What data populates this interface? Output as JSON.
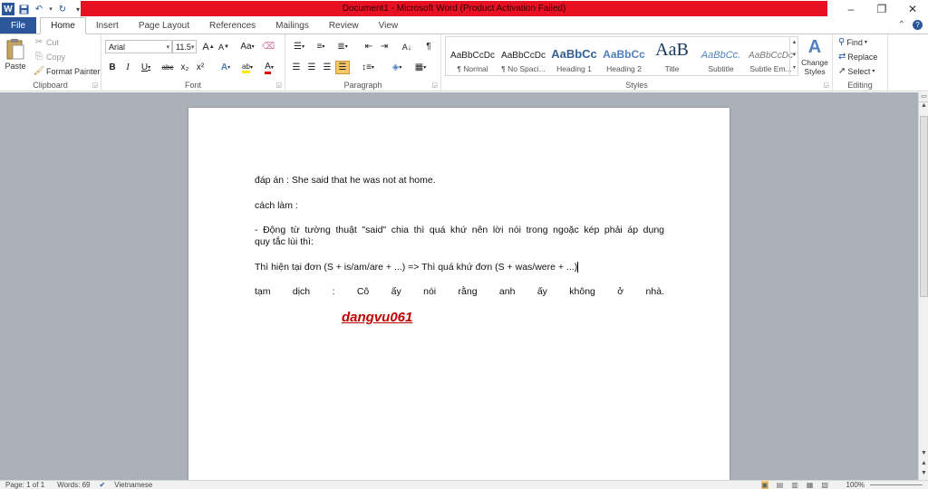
{
  "window": {
    "title": "Document1 - Microsoft Word (Product Activation Failed)",
    "minimize": "–",
    "restore": "❐",
    "close": "✕"
  },
  "tabs": [
    "File",
    "Home",
    "Insert",
    "Page Layout",
    "References",
    "Mailings",
    "Review",
    "View"
  ],
  "clipboard": {
    "paste": "Paste",
    "cut": "Cut",
    "copy": "Copy",
    "format_painter": "Format Painter",
    "label": "Clipboard"
  },
  "font": {
    "family": "Arial",
    "size": "11.5",
    "label": "Font",
    "bold": "B",
    "italic": "I",
    "underline": "U",
    "strike": "abc",
    "subscript": "x₂",
    "superscript": "x²",
    "grow": "A",
    "shrink": "A",
    "case": "Aa",
    "effects": "A",
    "highlight": "ab",
    "color": "A"
  },
  "paragraph": {
    "label": "Paragraph"
  },
  "styles": {
    "label": "Styles",
    "items": [
      {
        "preview": "AaBbCcDc",
        "name": "¶ Normal"
      },
      {
        "preview": "AaBbCcDc",
        "name": "¶ No Spaci..."
      },
      {
        "preview": "AaBbCc",
        "name": "Heading 1"
      },
      {
        "preview": "AaBbCc",
        "name": "Heading 2"
      },
      {
        "preview": "AaB",
        "name": "Title"
      },
      {
        "preview": "AaBbCc.",
        "name": "Subtitle"
      },
      {
        "preview": "AaBbCcDc",
        "name": "Subtle Em..."
      }
    ],
    "change_styles": "Change Styles"
  },
  "editing": {
    "find": "Find",
    "replace": "Replace",
    "select": "Select",
    "label": "Editing"
  },
  "document": {
    "line1": "đáp án : She said that he was not at home.",
    "line2": "cách làm :",
    "line3a": "- Động từ tường thuật \"said\" chia thì quá khứ nên lời nói trong ngoặc kép phải áp dụng",
    "line3b": "quy tắc lùi thì:",
    "line4": "Thì hiện tại đơn (S + is/am/are  + ...) => Thì quá khứ đơn (S + was/were  + ...)",
    "line5": "tạm dịch : Cô ấy nói rằng anh ấy không ở nhà.",
    "signature": "dangvu061"
  },
  "status": {
    "page": "Page: 1 of 1",
    "words": "Words: 69",
    "language": "Vietnamese",
    "zoom": "100%"
  }
}
